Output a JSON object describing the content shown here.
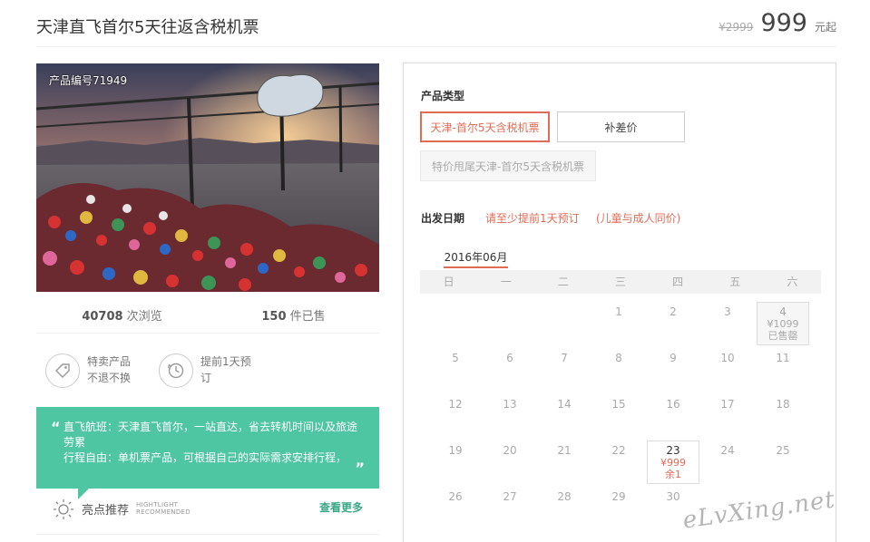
{
  "header": {
    "title": "天津直飞首尔5天往返含税机票",
    "old_price": "¥2999",
    "price": "999",
    "price_unit": "元起"
  },
  "photo": {
    "product_no": "产品编号71949"
  },
  "stats": {
    "views_num": "40708",
    "views_label": " 次浏览",
    "sold_num": "150",
    "sold_label": " 件已售"
  },
  "features": [
    {
      "icon": "tag-icon",
      "text": "特卖产品 不退不换"
    },
    {
      "icon": "clock-icon",
      "text": "提前1天预 订"
    }
  ],
  "highlight": {
    "line1": "直飞航班：天津直飞首尔，一站直达，省去转机时间以及旅途劳累",
    "line2": "行程自由：单机票产品，可根据自己的实际需求安排行程，",
    "open_quote": "“",
    "close_quote": "”"
  },
  "recommend": {
    "label": "亮点推荐",
    "en1": "HIGHTLIGHT",
    "en2": "RECOMMENDED",
    "see_more": "查看更多"
  },
  "panel": {
    "product_type_label": "产品类型",
    "options": [
      "天津-首尔5天含税机票",
      "补差价",
      "特价甩尾天津-首尔5天含税机票"
    ],
    "date_label": "出发日期",
    "date_hint1": "请至少提前1天预订",
    "date_hint2": "(儿童与成人同价)",
    "month": "2016年06月",
    "weekdays": [
      "日",
      "一",
      "二",
      "三",
      "四",
      "五",
      "六"
    ]
  },
  "calendar": {
    "day4_price": "¥1099",
    "day4_status": "已售罄",
    "day23_price": "¥999",
    "day23_status": "余1"
  },
  "watermark": "eLvXing.net",
  "colors": {
    "accent": "#e06c56",
    "green": "#4fc6a2"
  }
}
